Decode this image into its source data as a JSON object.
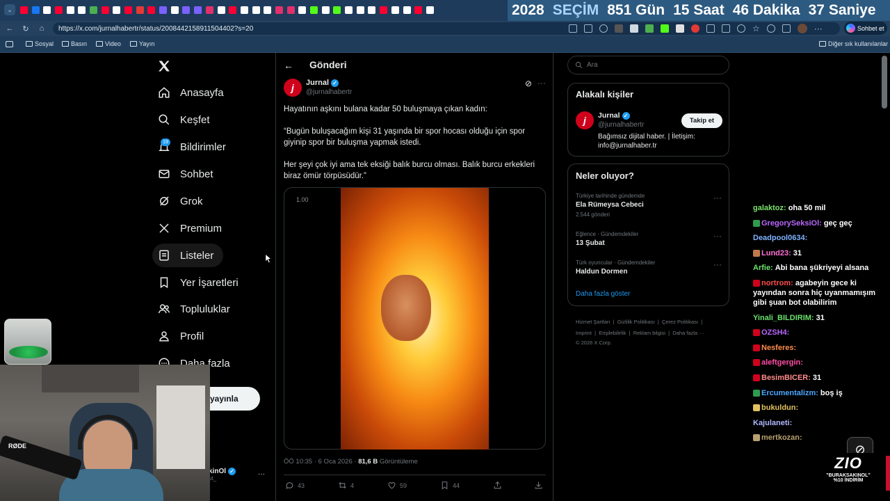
{
  "browser": {
    "url": "https://x.com/jurnalhabertr/status/2008442158911504402?s=20",
    "sohbet_label": "Sohbet et",
    "bookmarks": [
      "Sosyal",
      "Basın",
      "Video",
      "Yayın"
    ],
    "other_bookmarks": "Diğer sık kullanılanlar",
    "tab_colors": [
      "#ff0033",
      "#1877f2",
      "#ffffff",
      "#ff0033",
      "#ffffff",
      "#ffffff",
      "#4caf50",
      "#ff0033",
      "#ffffff",
      "#ff0033",
      "#e53935",
      "#ff0033",
      "#7b61ff",
      "#ffffff",
      "#7b61ff",
      "#7b61ff",
      "#e1306c",
      "#ffffff",
      "#ff0033",
      "#ffffff",
      "#ffffff",
      "#ffffff",
      "#e1306c",
      "#e1306c",
      "#ffffff",
      "#53fc18",
      "#ffffff",
      "#53fc18",
      "#ffffff",
      "#ffffff",
      "#ffffff",
      "#ff0033",
      "#ffffff",
      "#ffffff",
      "#ff0033",
      "#ffffff"
    ]
  },
  "countdown": {
    "year": "2028",
    "label": "SEÇİM",
    "days": "851",
    "days_label": "Gün",
    "hours": "15",
    "hours_label": "Saat",
    "minutes": "46",
    "minutes_label": "Dakika",
    "seconds": "37",
    "seconds_label": "Saniye"
  },
  "nav": {
    "items": [
      {
        "label": "Anasayfa",
        "icon": "home-icon"
      },
      {
        "label": "Keşfet",
        "icon": "search-icon"
      },
      {
        "label": "Bildirimler",
        "icon": "bell-icon",
        "badge": "19"
      },
      {
        "label": "Sohbet",
        "icon": "mail-icon"
      },
      {
        "label": "Grok",
        "icon": "grok-icon"
      },
      {
        "label": "Premium",
        "icon": "x-icon"
      },
      {
        "label": "Listeler",
        "icon": "list-icon"
      },
      {
        "label": "Yer İşaretleri",
        "icon": "bookmark-icon"
      },
      {
        "label": "Topluluklar",
        "icon": "people-icon"
      },
      {
        "label": "Profil",
        "icon": "person-icon"
      },
      {
        "label": "Daha fazla",
        "icon": "more-icon"
      }
    ],
    "post_button": "yayınla",
    "account_name_partial": "kinOl",
    "account_handle_partial": "ut_"
  },
  "post": {
    "header_title": "Gönderi",
    "author_name": "Jurnal",
    "author_handle": "@jurnalhabertr",
    "avatar_letter": "j",
    "text_p1": "Hayatının aşkını bulana kadar 50 buluşmaya çıkan kadın:",
    "text_p2": "“Bugün buluşacağım kişi 31 yaşında bir spor hocası olduğu için spor giyinip spor bir buluşma yapmak istedi.",
    "text_p3": "Her şeyi çok iyi ama tek eksiği balık burcu olması. Balık burcu erkekleri biraz ömür törpüsüdür.”",
    "video_speed": "1.00",
    "time": "ÖÖ 10:35 · 6 Oca 2026 ·",
    "views": "81,6 B",
    "views_label": "Görüntüleme",
    "replies": "43",
    "reposts": "4",
    "likes": "59",
    "bookmarks": "44"
  },
  "sidebar": {
    "search_placeholder": "Ara",
    "related_title": "Alakalı kişiler",
    "related_name": "Jurnal",
    "related_handle": "@jurnalhabertr",
    "follow_button": "Takip et",
    "related_bio": "Bağımsız dijital haber. | İletişim: info@jurnalhaber.tr",
    "trends_title": "Neler oluyor?",
    "trends": [
      {
        "meta": "Türkiye tarihinde gündemde",
        "name": "Ela Rümeysa Cebeci",
        "count": "2.544 gönderi"
      },
      {
        "meta": "Eğlence · Gündemdekiler",
        "name": "13 Şubat",
        "count": ""
      },
      {
        "meta": "Türk oyuncular · Gündemdekiler",
        "name": "Haldun Dormen",
        "count": ""
      }
    ],
    "show_more": "Daha fazla göster",
    "footer_row1": [
      "Hizmet Şartları",
      "Gizlilik Politikası",
      "Çerez Politikası"
    ],
    "footer_row2": [
      "Imprint",
      "Erişilebilirlik",
      "Reklam bilgisi",
      "Daha fazla ···"
    ],
    "copyright": "© 2026 X Corp."
  },
  "chat": [
    {
      "user": "galaktoz:",
      "msg": "oha 50 mil",
      "color": "#7be36b",
      "badge": ""
    },
    {
      "user": "GregorySeksiOl:",
      "msg": "geç geç",
      "color": "#b967ff",
      "badge": "#2e9b4e"
    },
    {
      "user": "Deadpool0634:",
      "msg": "",
      "color": "#7fb2ff",
      "badge": ""
    },
    {
      "user": "Lund23:",
      "msg": "31",
      "color": "#ff6fd8",
      "badge": "#c07a4a"
    },
    {
      "user": "Arfie:",
      "msg": "Abi bana şükriyeyi alsana",
      "color": "#6be36b",
      "badge": ""
    },
    {
      "user": "nortrom:",
      "msg": "agabeyin gece ki yayından sonra hiç uyanmamışım gibi şuan bot olabilirim",
      "color": "#ff4d4d",
      "badge": "#d0021b"
    },
    {
      "user": "Yinali_BILDIRIM:",
      "msg": "31",
      "color": "#6be36b",
      "badge": ""
    },
    {
      "user": "OZSH4:",
      "msg": "",
      "color": "#b967ff",
      "badge": "#d0021b"
    },
    {
      "user": "Nesferes:",
      "msg": "",
      "color": "#ff8c4d",
      "badge": "#d0021b"
    },
    {
      "user": "aleftgergin:",
      "msg": "",
      "color": "#ff4da6",
      "badge": "#d0021b"
    },
    {
      "user": "BesimBICER:",
      "msg": "31",
      "color": "#ff8c8c",
      "badge": "#d0021b"
    },
    {
      "user": "Ercumentalizm:",
      "msg": "boş iş",
      "color": "#4da6ff",
      "badge": "#2e9b4e"
    },
    {
      "user": "bukuldun:",
      "msg": "",
      "color": "#e0c060",
      "badge": "#e0c060"
    },
    {
      "user": "Kajulaneti:",
      "msg": "",
      "color": "#b0b8ff",
      "badge": ""
    },
    {
      "user": "mertkozan:",
      "msg": "",
      "color": "#b8a070",
      "badge": "#b8a070"
    }
  ],
  "stream": {
    "brand": "ZIO",
    "promo_code": "\"BURAKSAKINOL\"",
    "promo_text": "%10 İNDİRİM",
    "mic_label": "RØDE"
  }
}
